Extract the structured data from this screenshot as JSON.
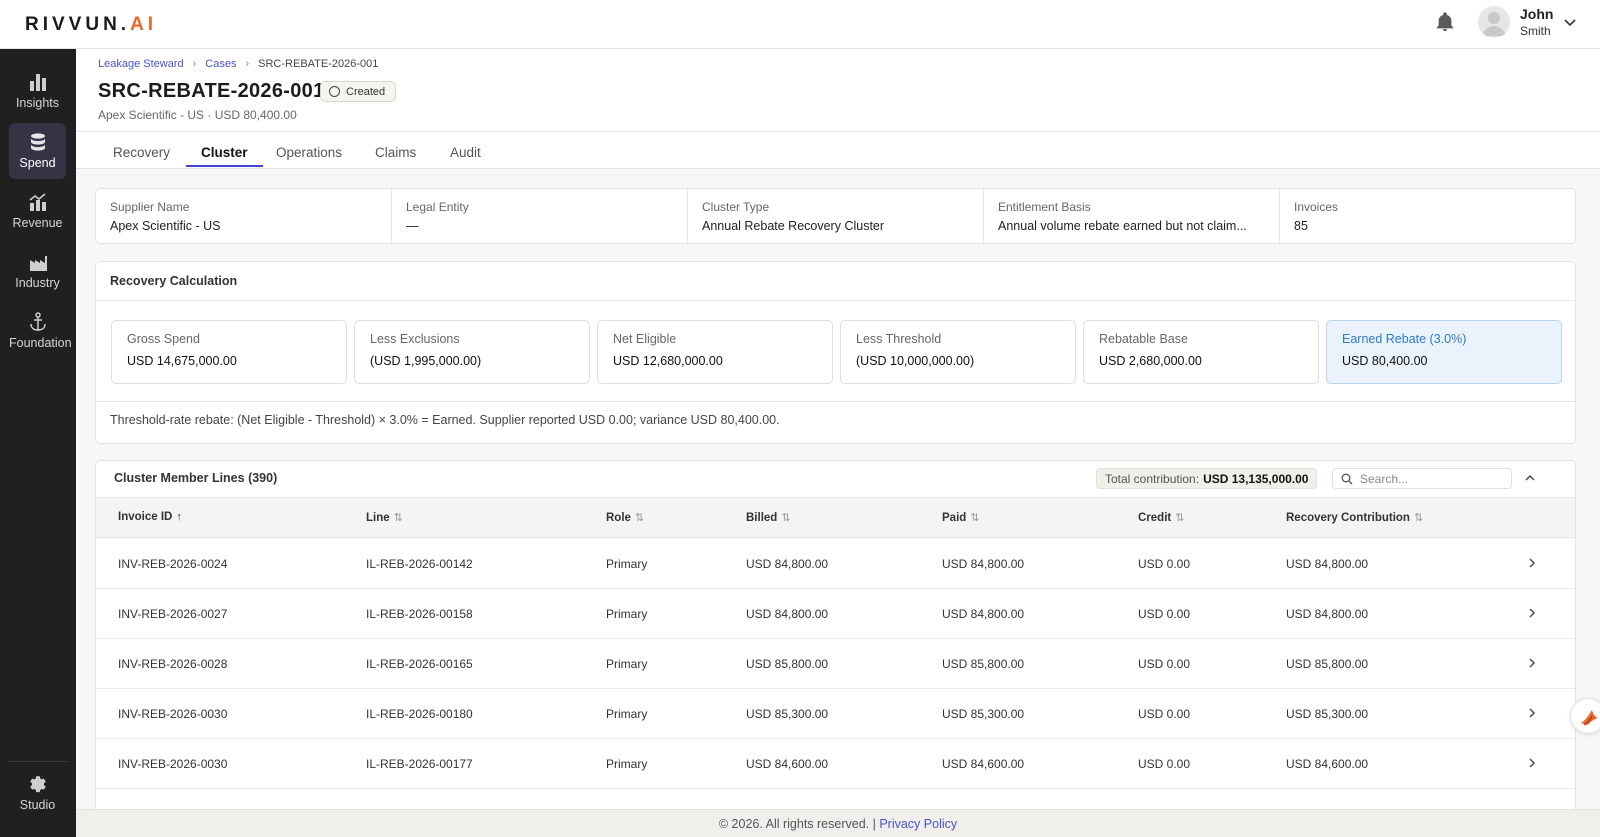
{
  "brand": {
    "logo_main": "RIVVUN.",
    "logo_accent": "AI"
  },
  "user": {
    "first_name": "John",
    "last_name": "Smith"
  },
  "sidebar": {
    "items": [
      {
        "label": "Insights",
        "icon": "bar-chart-icon"
      },
      {
        "label": "Spend",
        "icon": "database-icon",
        "active": true
      },
      {
        "label": "Revenue",
        "icon": "revenue-chart-icon"
      },
      {
        "label": "Industry",
        "icon": "factory-icon"
      },
      {
        "label": "Foundation",
        "icon": "anchor-icon"
      }
    ],
    "bottom": {
      "label": "Studio",
      "icon": "gear-icon"
    }
  },
  "breadcrumb": [
    "Leakage Steward",
    "Cases",
    "SRC-REBATE-2026-001"
  ],
  "page": {
    "title": "SRC-REBATE-2026-001",
    "status": "Created",
    "subtitle": "Apex Scientific - US · USD 80,400.00"
  },
  "tabs": [
    "Recovery",
    "Cluster",
    "Operations",
    "Claims",
    "Audit"
  ],
  "active_tab": "Cluster",
  "info": [
    {
      "label": "Supplier Name",
      "value": "Apex Scientific - US"
    },
    {
      "label": "Legal Entity",
      "value": "—"
    },
    {
      "label": "Cluster Type",
      "value": "Annual Rebate Recovery Cluster"
    },
    {
      "label": "Entitlement Basis",
      "value": "Annual volume rebate earned but not claim..."
    },
    {
      "label": "Invoices",
      "value": "85"
    }
  ],
  "recovery": {
    "title": "Recovery Calculation",
    "metrics": [
      {
        "label": "Gross Spend",
        "value": "USD 14,675,000.00"
      },
      {
        "label": "Less Exclusions",
        "value": "(USD 1,995,000.00)"
      },
      {
        "label": "Net Eligible",
        "value": "USD 12,680,000.00"
      },
      {
        "label": "Less Threshold",
        "value": "(USD 10,000,000.00)"
      },
      {
        "label": "Rebatable Base",
        "value": "USD 2,680,000.00"
      },
      {
        "label": "Earned Rebate (3.0%)",
        "value": "USD 80,400.00",
        "highlight": true
      }
    ],
    "formula": "Threshold-rate rebate: (Net Eligible - Threshold) × 3.0% = Earned. Supplier reported USD 0.00; variance USD 80,400.00."
  },
  "cluster": {
    "title": "Cluster Member Lines (390)",
    "total_label": "Total contribution:",
    "total_value": "USD 13,135,000.00",
    "search_placeholder": "Search...",
    "columns": [
      "Invoice ID",
      "Line",
      "Role",
      "Billed",
      "Paid",
      "Credit",
      "Recovery Contribution"
    ],
    "rows": [
      [
        "INV-REB-2026-0024",
        "IL-REB-2026-00142",
        "Primary",
        "USD 84,800.00",
        "USD 84,800.00",
        "USD 0.00",
        "USD 84,800.00"
      ],
      [
        "INV-REB-2026-0027",
        "IL-REB-2026-00158",
        "Primary",
        "USD 84,800.00",
        "USD 84,800.00",
        "USD 0.00",
        "USD 84,800.00"
      ],
      [
        "INV-REB-2026-0028",
        "IL-REB-2026-00165",
        "Primary",
        "USD 85,800.00",
        "USD 85,800.00",
        "USD 0.00",
        "USD 85,800.00"
      ],
      [
        "INV-REB-2026-0030",
        "IL-REB-2026-00180",
        "Primary",
        "USD 85,300.00",
        "USD 85,300.00",
        "USD 0.00",
        "USD 85,300.00"
      ],
      [
        "INV-REB-2026-0030",
        "IL-REB-2026-00177",
        "Primary",
        "USD 84,600.00",
        "USD 84,600.00",
        "USD 0.00",
        "USD 84,600.00"
      ]
    ]
  },
  "footer": {
    "text": "© 2026. All rights reserved. |",
    "link": "Privacy Policy"
  },
  "colors": {
    "accent": "#3f48cc",
    "brand_orange": "#e8672a",
    "sidebar_bg": "#211f1f",
    "highlight_bg": "#eaf3fb"
  }
}
